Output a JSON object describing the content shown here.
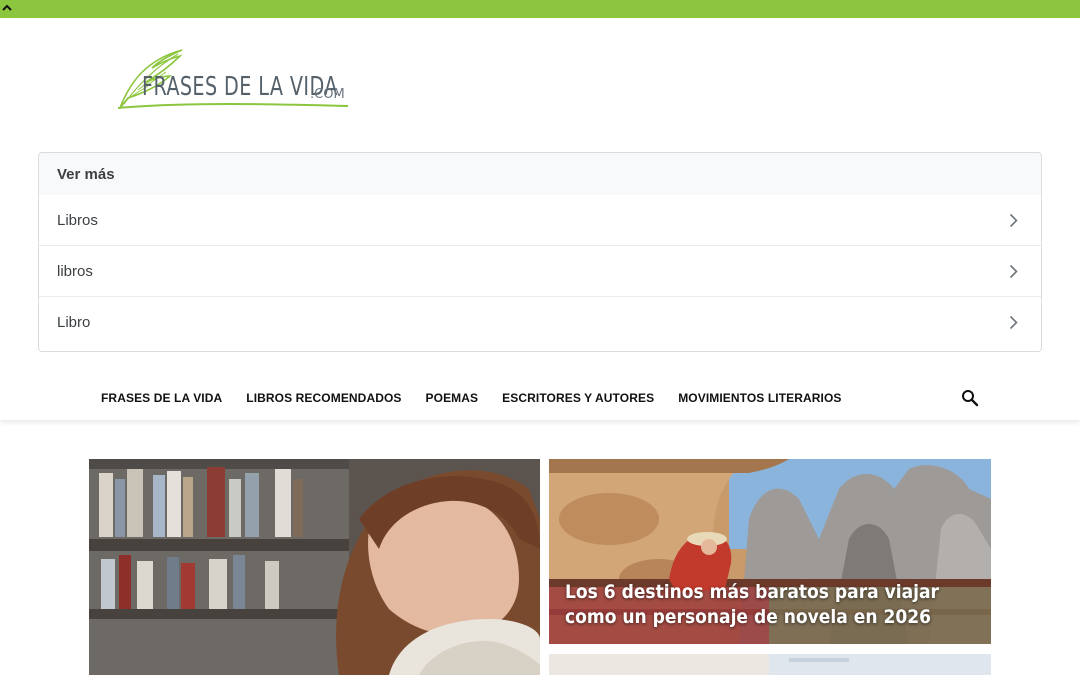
{
  "logo": {
    "text": "FRASES DE LA VIDA",
    "suffix": ".COM"
  },
  "related_searches": {
    "header": "Ver más",
    "items": [
      {
        "label": "Libros"
      },
      {
        "label": "libros"
      },
      {
        "label": "Libro"
      }
    ]
  },
  "nav": {
    "items": [
      {
        "label": "FRASES DE LA VIDA"
      },
      {
        "label": "LIBROS RECOMENDADOS"
      },
      {
        "label": "POEMAS"
      },
      {
        "label": "ESCRITORES Y AUTORES"
      },
      {
        "label": "MOVIMIENTOS LITERARIOS"
      }
    ],
    "search_icon": "search-icon"
  },
  "featured": {
    "side_card": {
      "title": "Los 6 destinos más baratos para viajar como un personaje de novela en 2026"
    }
  },
  "colors": {
    "accent": "#8cc63f",
    "text_dark": "#111111",
    "box_border": "#dadce0"
  },
  "icons": {
    "collapse": "chevron-up-icon",
    "item_arrow": "chevron-right-icon"
  }
}
